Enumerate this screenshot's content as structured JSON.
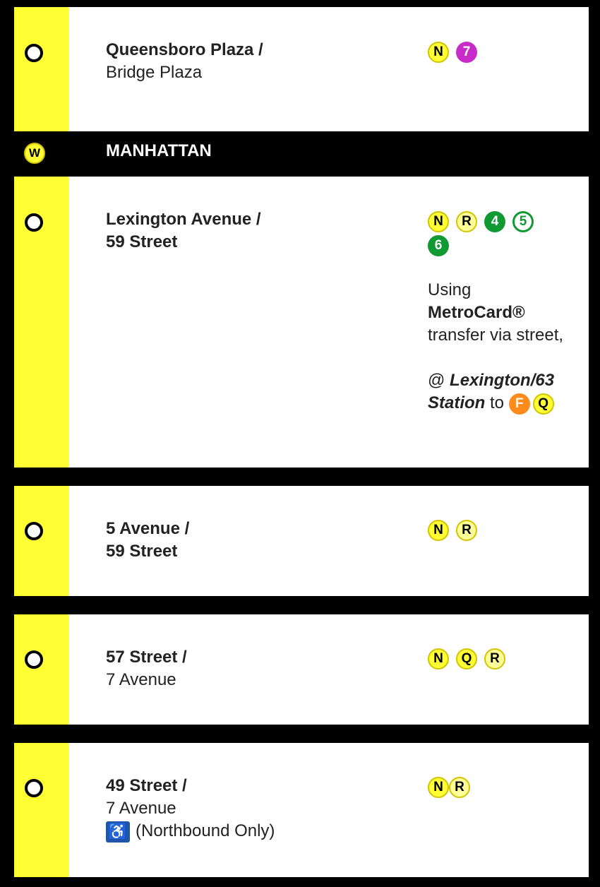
{
  "stations": [
    {
      "name_line1": "Queensboro Plaza /",
      "name_line2": "Bridge Plaza",
      "line2_bold": false,
      "bullets": [
        {
          "label": "N",
          "style": "yellow"
        },
        {
          "label": "7",
          "style": "purple"
        }
      ]
    },
    {
      "name_line1": "Lexington Avenue /",
      "name_line2": "59 Street",
      "line2_bold": true,
      "bullets": [
        {
          "label": "N",
          "style": "yellow"
        },
        {
          "label": "R",
          "style": "yellow-hollow"
        },
        {
          "label": "4",
          "style": "green"
        },
        {
          "label": "5",
          "style": "green-hollow"
        },
        {
          "label": "6",
          "style": "green"
        }
      ]
    },
    {
      "name_line1": "5 Avenue /",
      "name_line2": "59 Street",
      "line2_bold": true,
      "bullets": [
        {
          "label": "N",
          "style": "yellow"
        },
        {
          "label": "R",
          "style": "yellow-hollow"
        }
      ]
    },
    {
      "name_line1": "57 Street /",
      "name_line2": "7 Avenue",
      "line2_bold": false,
      "bullets": [
        {
          "label": "N",
          "style": "yellow"
        },
        {
          "label": "Q",
          "style": "yellow"
        },
        {
          "label": "R",
          "style": "yellow-hollow"
        }
      ]
    },
    {
      "name_line1": "49 Street /",
      "name_line2": "7 Avenue",
      "line2_bold": false,
      "bullets": [
        {
          "label": "N",
          "style": "yellow"
        },
        {
          "label": "R",
          "style": "yellow-hollow"
        }
      ],
      "accessible_note": "(Northbound Only)",
      "accessible_icon": "wheelchair-icon"
    }
  ],
  "borough": {
    "bullet": "W",
    "name": "MANHATTAN"
  },
  "transfer_note": {
    "using": "Using",
    "metrocard": "MetroCard®",
    "via": "transfer via street,",
    "at": "@",
    "station_name": "Lexington/63",
    "station_word": "Station",
    "to": "to",
    "bullets": [
      {
        "label": "F",
        "style": "orange"
      },
      {
        "label": "Q",
        "style": "yellow"
      }
    ]
  },
  "colors": {
    "line_yellow": "#ffff33",
    "purple_7": "#c82cc8",
    "green_456": "#119933",
    "orange_F": "#ff8c1a"
  }
}
